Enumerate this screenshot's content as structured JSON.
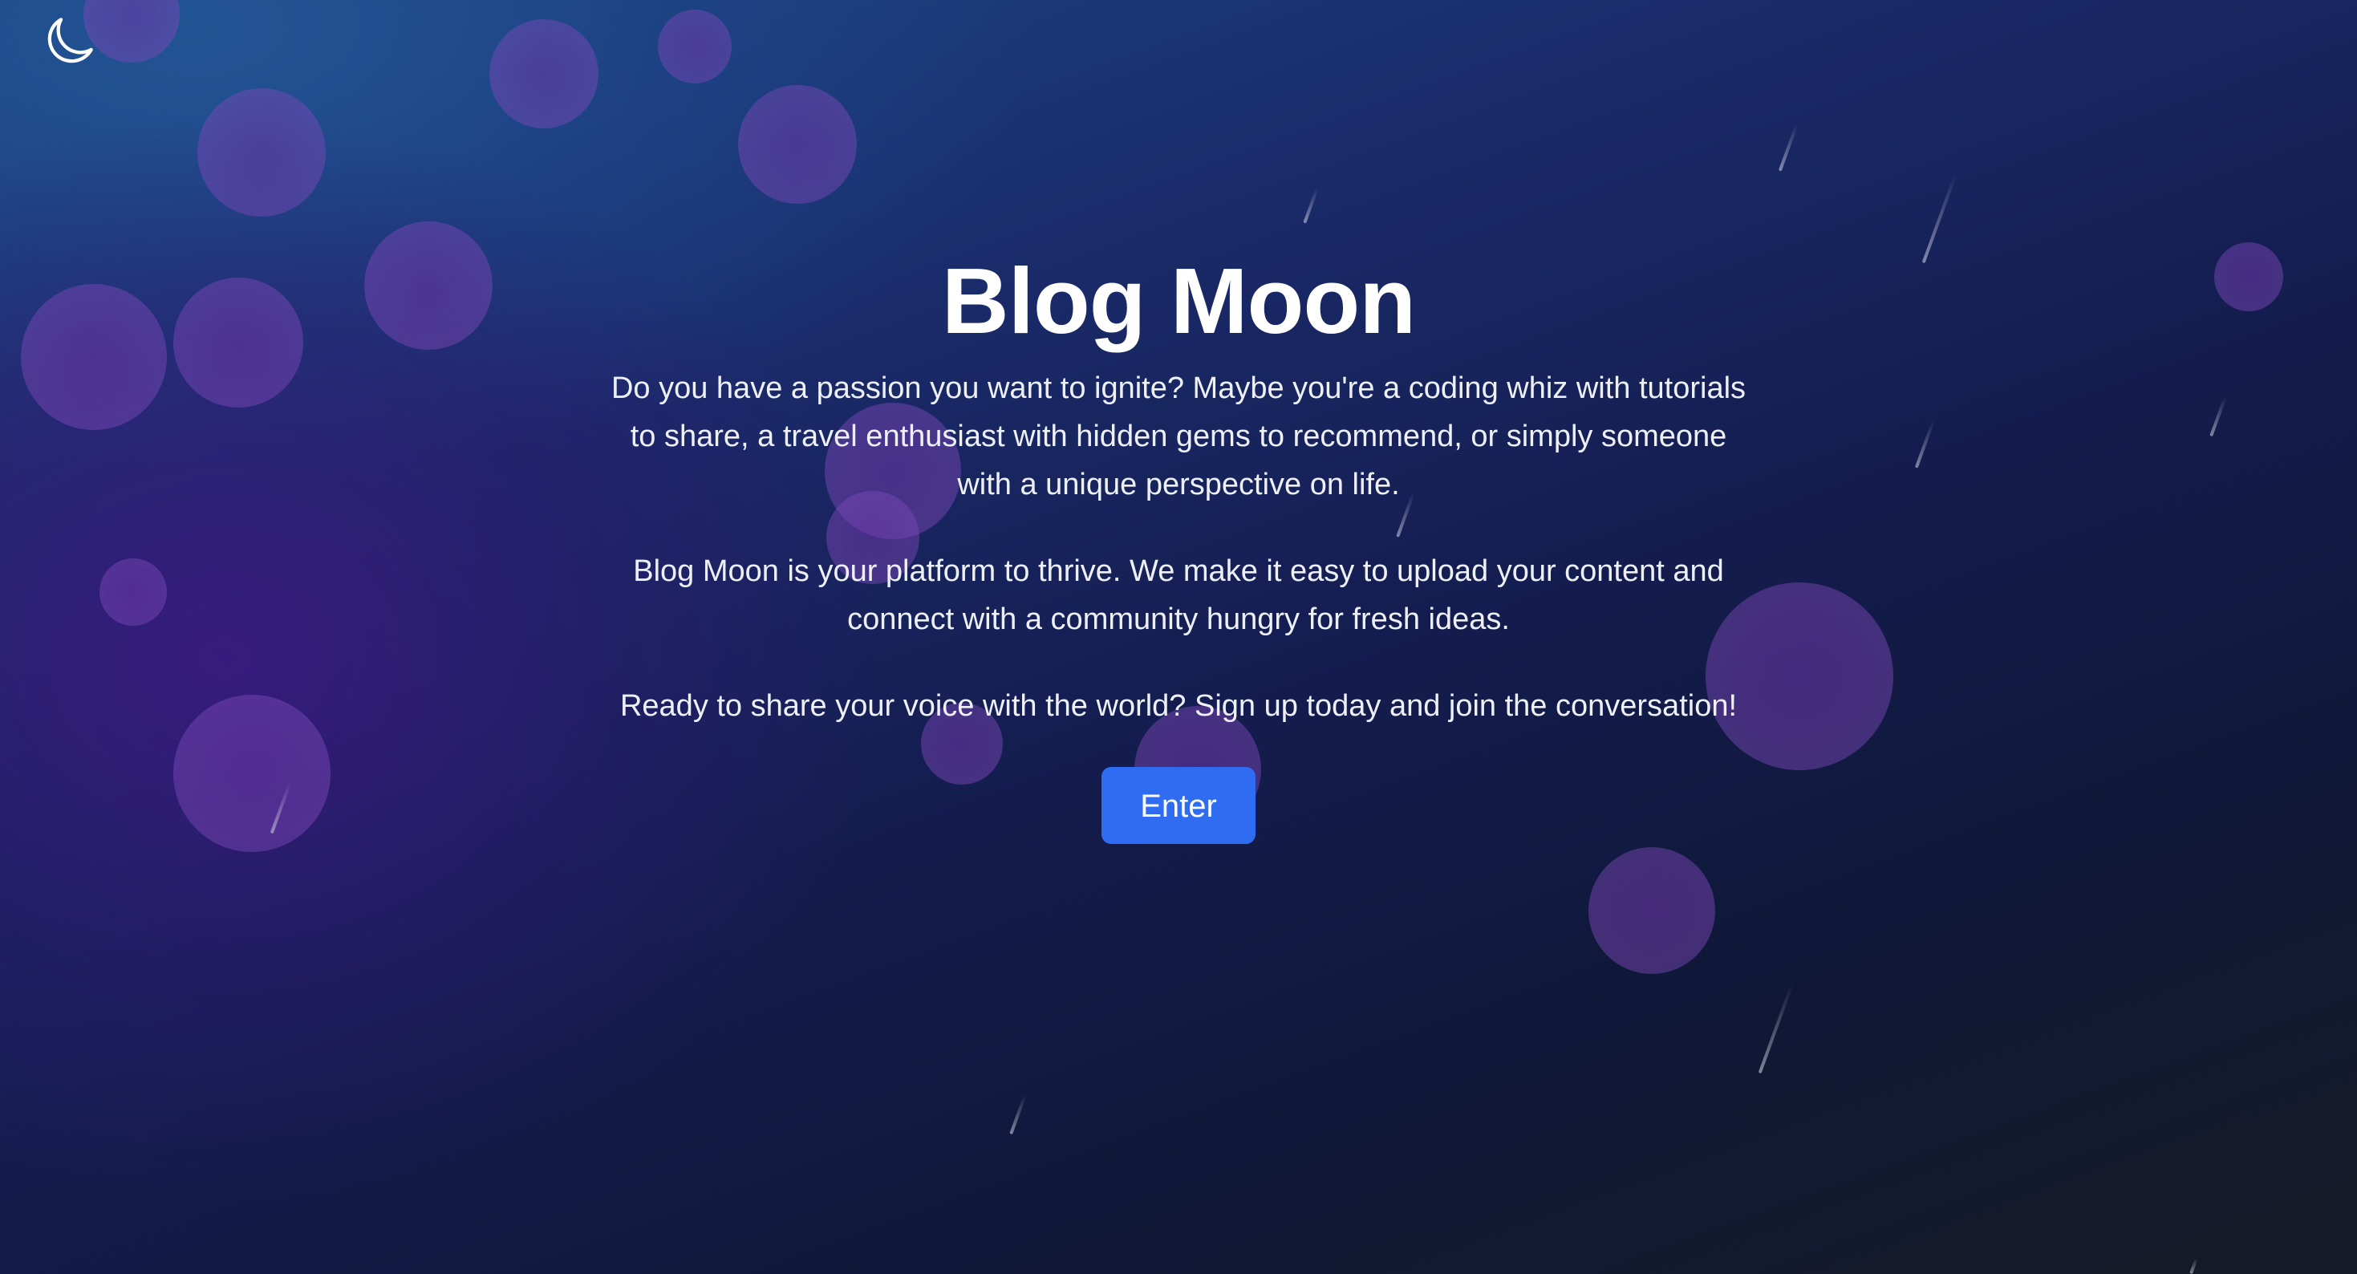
{
  "theme_toggle": {
    "icon": "moon-icon"
  },
  "hero": {
    "title": "Blog Moon",
    "paragraph_1": "Do you have a passion you want to ignite? Maybe you're a coding whiz with tutorials to share, a travel enthusiast with hidden gems to recommend, or simply someone with a unique perspective on life.",
    "paragraph_2": "Blog Moon is your platform to thrive. We make it easy to upload your content and connect with a community hungry for fresh ideas.",
    "paragraph_3": "Ready to share your voice with the world? Sign up today and join the conversation!",
    "enter_label": "Enter"
  },
  "colors": {
    "accent": "#2f6cf2",
    "bubble": "#7a45b8",
    "text": "#eef0f8"
  }
}
